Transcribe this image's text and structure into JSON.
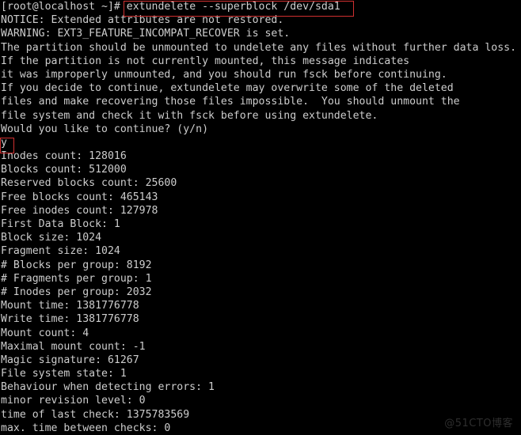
{
  "terminal": {
    "background_color": "#000000",
    "text_color": "#cdcdcd",
    "highlight_color": "#d03030",
    "partial_top_line": "  #",
    "prompt": "[root@localhost ~]# ",
    "command": "extundelete --superblock /dev/sda1",
    "answer_input": "y",
    "output_lines": [
      "NOTICE: Extended attributes are not restored.",
      "WARNING: EXT3_FEATURE_INCOMPAT_RECOVER is set.",
      "The partition should be unmounted to undelete any files without further data loss.",
      "If the partition is not currently mounted, this message indicates",
      "it was improperly unmounted, and you should run fsck before continuing.",
      "If you decide to continue, extundelete may overwrite some of the deleted",
      "files and make recovering those files impossible.  You should unmount the",
      "file system and check it with fsck before using extundelete.",
      "Would you like to continue? (y/n)"
    ],
    "superblock_lines": [
      "Inodes count: 128016",
      "Blocks count: 512000",
      "Reserved blocks count: 25600",
      "Free blocks count: 465143",
      "Free inodes count: 127978",
      "First Data Block: 1",
      "Block size: 1024",
      "Fragment size: 1024",
      "# Blocks per group: 8192",
      "# Fragments per group: 1",
      "# Inodes per group: 2032",
      "Mount time: 1381776778",
      "Write time: 1381776778",
      "Mount count: 4",
      "Maximal mount count: -1",
      "Magic signature: 61267",
      "File system state: 1",
      "Behaviour when detecting errors: 1",
      "minor revision level: 0",
      "time of last check: 1375783569",
      "max. time between checks: 0"
    ]
  },
  "watermark": {
    "text": "@51CTO博客"
  }
}
